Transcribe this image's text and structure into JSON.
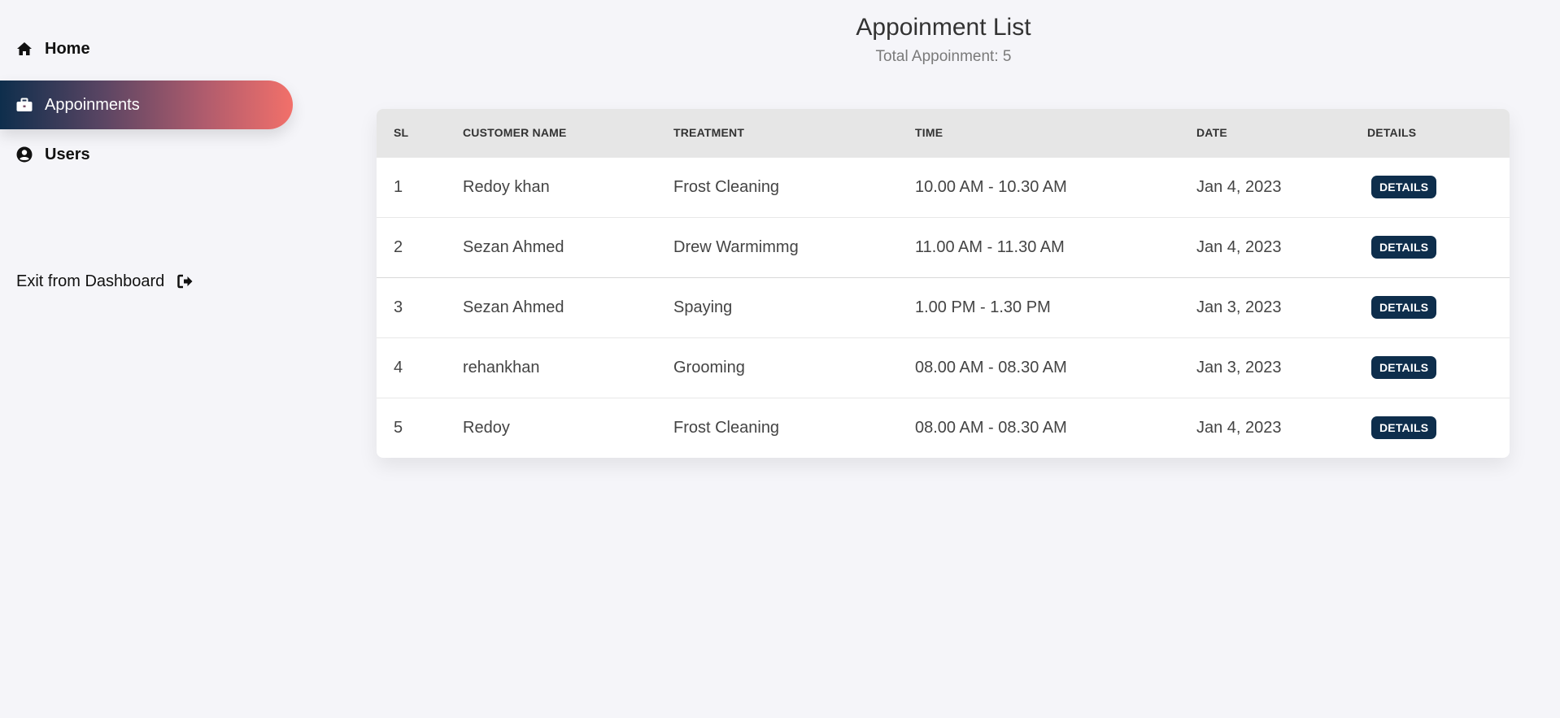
{
  "sidebar": {
    "items": [
      {
        "label": "Home",
        "icon": "home-icon"
      },
      {
        "label": "Appoinments",
        "icon": "briefcase-icon"
      },
      {
        "label": "Users",
        "icon": "user-circle-icon"
      }
    ],
    "exit_label": "Exit from Dashboard",
    "exit_icon": "sign-out-icon"
  },
  "header": {
    "title": "Appoinment List",
    "subtitle": "Total Appoinment: 5"
  },
  "table": {
    "columns": [
      "SL",
      "CUSTOMER NAME",
      "TREATMENT",
      "TIME",
      "DATE",
      "DETAILS"
    ],
    "rows": [
      {
        "sl": "1",
        "customer": "Redoy khan",
        "treatment": "Frost Cleaning",
        "time": "10.00 AM - 10.30 AM",
        "date": "Jan 4, 2023",
        "action": "DETAILS"
      },
      {
        "sl": "2",
        "customer": "Sezan Ahmed",
        "treatment": "Drew Warmimmg",
        "time": "11.00 AM - 11.30 AM",
        "date": "Jan 4, 2023",
        "action": "DETAILS"
      },
      {
        "sl": "3",
        "customer": "Sezan Ahmed",
        "treatment": "Spaying",
        "time": "1.00 PM - 1.30 PM",
        "date": "Jan 3, 2023",
        "action": "DETAILS"
      },
      {
        "sl": "4",
        "customer": "rehankhan",
        "treatment": "Grooming",
        "time": "08.00 AM - 08.30 AM",
        "date": "Jan 3, 2023",
        "action": "DETAILS"
      },
      {
        "sl": "5",
        "customer": "Redoy",
        "treatment": "Frost Cleaning",
        "time": "08.00 AM - 08.30 AM",
        "date": "Jan 4, 2023",
        "action": "DETAILS"
      }
    ]
  },
  "colors": {
    "accent_dark": "#0e2e4c",
    "accent_light": "#f2706a",
    "background": "#f5f5f9"
  }
}
